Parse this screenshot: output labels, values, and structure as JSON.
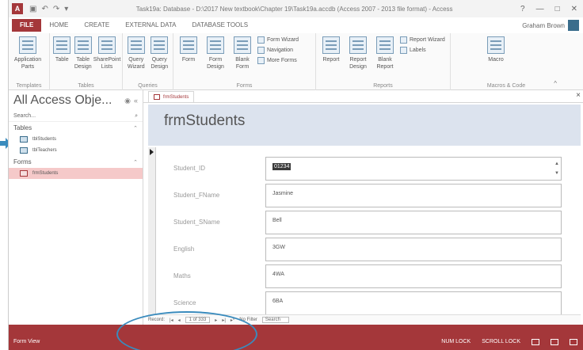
{
  "window": {
    "app_icon": "A",
    "title": "Task19a: Database - D:\\2017 New textbook\\Chapter 19\\Task19a.accdb (Access 2007 - 2013 file format) - Access",
    "qat_icons": [
      "save-icon",
      "undo-icon",
      "redo-icon",
      "dropdown-icon"
    ],
    "controls": [
      "?",
      "—",
      "□",
      "✕"
    ]
  },
  "tabs": [
    "FILE",
    "HOME",
    "CREATE",
    "EXTERNAL DATA",
    "DATABASE TOOLS"
  ],
  "user": "Graham Brown",
  "ribbon": {
    "groups": [
      {
        "label": "Templates",
        "buttons": [
          "Application Parts"
        ]
      },
      {
        "label": "Tables",
        "buttons": [
          "Table",
          "Table Design",
          "SharePoint Lists"
        ]
      },
      {
        "label": "Queries",
        "buttons": [
          "Query Wizard",
          "Query Design"
        ]
      },
      {
        "label": "Forms",
        "buttons": [
          "Form",
          "Form Design",
          "Blank Form"
        ],
        "small": [
          "Form Wizard",
          "Navigation",
          "More Forms"
        ]
      },
      {
        "label": "Reports",
        "buttons": [
          "Report",
          "Report Design",
          "Blank Report"
        ],
        "small": [
          "Report Wizard",
          "Labels"
        ]
      },
      {
        "label": "Macros & Code",
        "buttons": [
          "Macro"
        ]
      }
    ]
  },
  "nav": {
    "title": "All Access Obje...",
    "search_placeholder": "Search...",
    "sections": [
      {
        "name": "Tables",
        "items": [
          "tblStudents",
          "tblTeachers"
        ]
      },
      {
        "name": "Forms",
        "items": [
          "frmStudents"
        ]
      }
    ]
  },
  "document": {
    "tab_label": "frmStudents",
    "form_title": "frmStudents",
    "fields": [
      {
        "label": "Student_ID",
        "value": "01234"
      },
      {
        "label": "Student_FName",
        "value": "Jasmine"
      },
      {
        "label": "Student_SName",
        "value": "Bell"
      },
      {
        "label": "English",
        "value": "3GW"
      },
      {
        "label": "Maths",
        "value": "4WA"
      },
      {
        "label": "Science",
        "value": "6BA"
      }
    ],
    "record_nav": {
      "label": "Record:",
      "position": "1 of 333",
      "filter": "No Filter",
      "search": "Search"
    }
  },
  "status": {
    "view": "Form View",
    "indicators": [
      "NUM LOCK",
      "SCROLL LOCK"
    ]
  },
  "colors": {
    "accent": "#a4373a",
    "form_header": "#dce3ee",
    "annotation": "#3a8bbd"
  }
}
